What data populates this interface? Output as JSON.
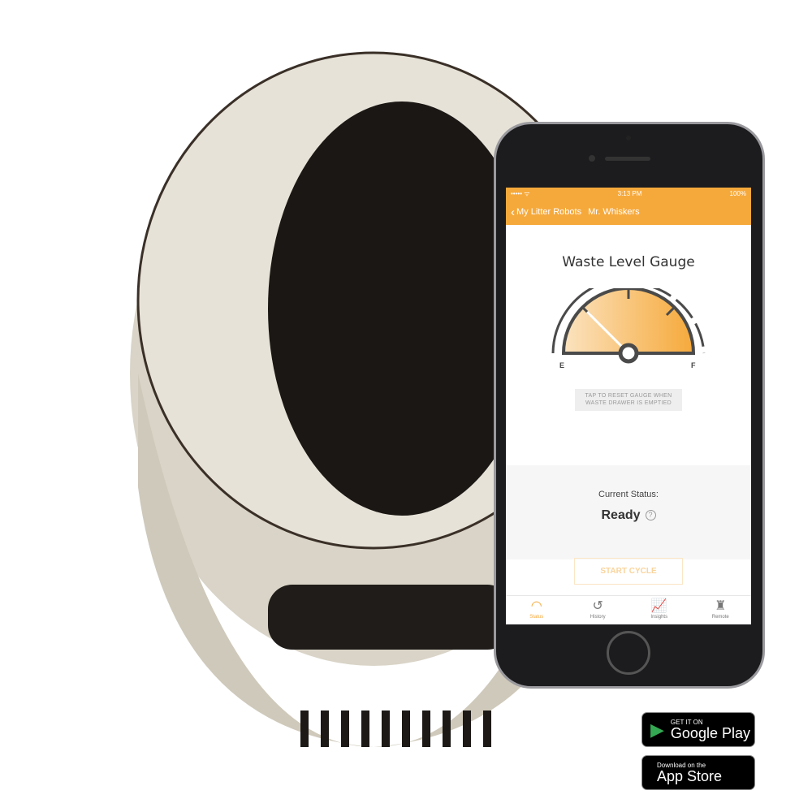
{
  "statusbar": {
    "signal": "••••• ᯤ",
    "time": "3:13 PM",
    "battery": "100%"
  },
  "nav": {
    "back_label": "My Litter Robots",
    "title": "Mr. Whiskers"
  },
  "gauge": {
    "title": "Waste Level Gauge",
    "empty_label": "E",
    "full_label": "F",
    "level": 0.25,
    "accent": "#f6a93b",
    "hint": "TAP TO RESET GAUGE WHEN WASTE DRAWER IS EMPTIED"
  },
  "status": {
    "label": "Current Status:",
    "value": "Ready",
    "help": "?"
  },
  "start_button": "START CYCLE",
  "tabs": [
    {
      "label": "Status",
      "icon": "gauge-icon"
    },
    {
      "label": "History",
      "icon": "history-icon"
    },
    {
      "label": "Insights",
      "icon": "chart-icon"
    },
    {
      "label": "Remote",
      "icon": "remote-icon"
    }
  ],
  "badges": {
    "google": {
      "small": "GET IT ON",
      "big": "Google Play"
    },
    "apple": {
      "small": "Download on the",
      "big": "App Store"
    }
  }
}
